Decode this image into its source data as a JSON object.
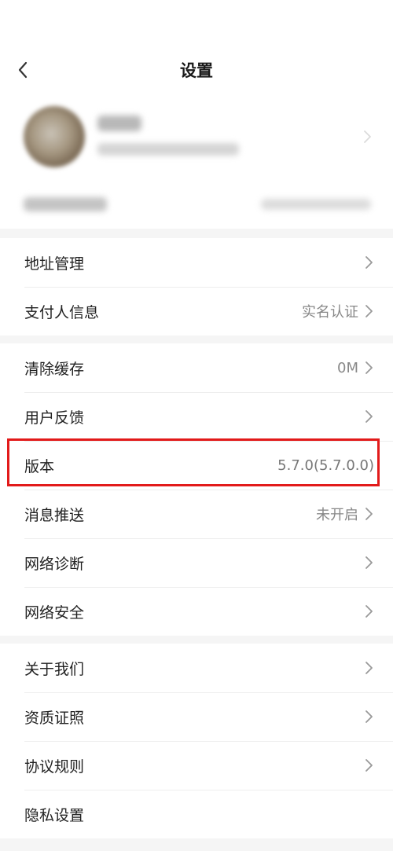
{
  "header": {
    "title": "设置"
  },
  "sections": [
    {
      "items": [
        {
          "label": "地址管理",
          "value": ""
        },
        {
          "label": "支付人信息",
          "value": "实名认证"
        }
      ]
    },
    {
      "items": [
        {
          "label": "清除缓存",
          "value": "0M"
        },
        {
          "label": "用户反馈",
          "value": ""
        },
        {
          "label": "版本",
          "value": "5.7.0(5.7.0.0)"
        },
        {
          "label": "消息推送",
          "value": "未开启"
        },
        {
          "label": "网络诊断",
          "value": ""
        },
        {
          "label": "网络安全",
          "value": ""
        }
      ]
    },
    {
      "items": [
        {
          "label": "关于我们",
          "value": ""
        },
        {
          "label": "资质证照",
          "value": ""
        },
        {
          "label": "协议规则",
          "value": ""
        },
        {
          "label": "隐私设置",
          "value": ""
        }
      ]
    }
  ],
  "colors": {
    "highlight": "#e21a1a",
    "background": "#f5f5f5",
    "card": "#ffffff"
  },
  "icons": {
    "back": "chevron-left-icon",
    "row": "chevron-right-icon"
  }
}
